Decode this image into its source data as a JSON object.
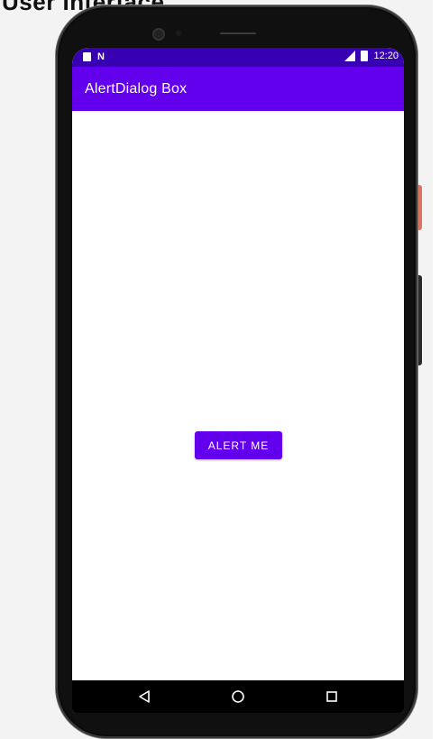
{
  "page": {
    "heading": "User Interface"
  },
  "status_bar": {
    "time": "12:20",
    "network_letter": "N"
  },
  "app_bar": {
    "title": "AlertDialog Box"
  },
  "main": {
    "alert_button_label": "ALERT ME"
  },
  "nav_bar": {
    "back_icon": "back-icon",
    "home_icon": "home-icon",
    "recents_icon": "recents-icon"
  },
  "colors": {
    "primary": "#6200ee",
    "primary_dark": "#3700b3",
    "background": "#ffffff"
  }
}
